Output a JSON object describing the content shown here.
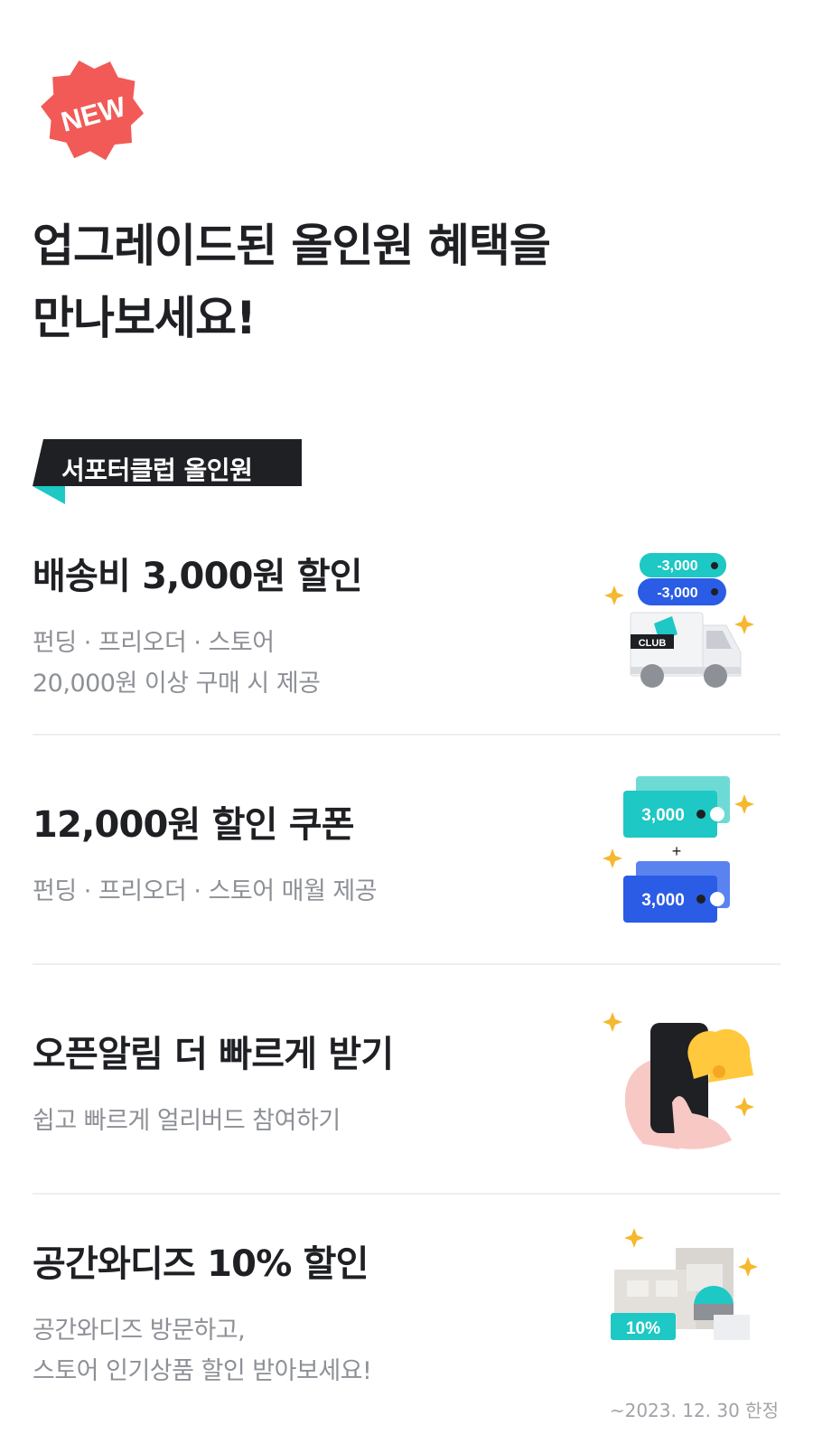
{
  "badge": {
    "label": "NEW",
    "color": "#f15a56"
  },
  "headline": {
    "line1": "업그레이드된 올인원 혜택을",
    "line2": "만나보세요!"
  },
  "section_tag": {
    "label": "서포터클럽 올인원",
    "accent": "#1ec8c4"
  },
  "benefits": [
    {
      "title": "배송비 3,000원 할인",
      "desc_line1": "펀딩 · 프리오더 · 스토어",
      "desc_line2": "20,000원 이상 구매 시 제공",
      "illustration": {
        "icon": "delivery-truck-icon",
        "coupon_top": "-3,000",
        "coupon_bottom": "-3,000",
        "truck_label": "CLUB"
      }
    },
    {
      "title": "12,000원 할인 쿠폰",
      "desc_line1": "펀딩 · 프리오더 · 스토어 매월 제공",
      "illustration": {
        "icon": "coupon-ticket-icon",
        "coupon_top": "3,000",
        "plus": "+",
        "coupon_bottom": "3,000"
      }
    },
    {
      "title": "오픈알림 더 빠르게 받기",
      "desc_line1": "쉽고 빠르게 얼리버드 참여하기",
      "illustration": {
        "icon": "phone-bell-icon"
      }
    },
    {
      "title": "공간와디즈 10% 할인",
      "desc_line1": "공간와디즈 방문하고,",
      "desc_line2": "스토어 인기상품 할인 받아보세요!",
      "illustration": {
        "icon": "store-space-icon",
        "discount": "10%"
      },
      "note": "~2023. 12. 30 한정"
    }
  ],
  "colors": {
    "teal": "#1ec8c4",
    "blue": "#2b5ce6",
    "dark": "#1f2024",
    "yellow": "#ffc83d",
    "sparkle": "#f5b82e"
  }
}
